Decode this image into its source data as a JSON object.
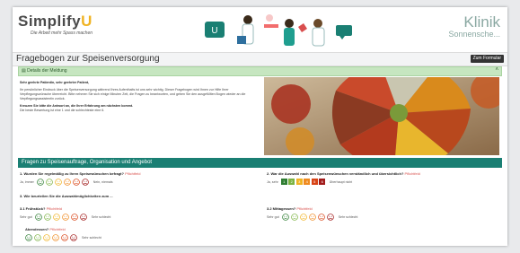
{
  "header": {
    "brand": "Simplify",
    "brand_accent": "U",
    "tagline": "Die Arbeit mehr Spass machen",
    "klinik_line1": "Klinik",
    "klinik_line2": "Sonnensche..."
  },
  "page": {
    "title": "Fragebogen zur Speisenversorgung",
    "forms_button": "Zum Formular"
  },
  "info": {
    "header_label": "Details der Meldung",
    "greeting": "Sehr geehrte Patientin, sehr geehrter Patient,",
    "para1": "Ihr persönlicher Eindruck über die Speisenversorgung während Ihres Aufenthalts ist uns sehr wichtig. Dieser Fragebogen wird Ihnen zur Hilfe Ihrer Verpflegungswünsche überreicht. Bitte nehmen Sie sich einige Minuten Zeit, die Fragen zu beantworten, und geben Sie den ausgefüllten Bogen wieder an die Verpflegungsassistentin zurück.",
    "para2_bold": "Kreuzen Sie bitte die Antwort an, die Ihrer Erfahrung am nächsten kommt.",
    "para3": "Die beste Bewertung ist eine 1 und die schlechteste eine 6."
  },
  "section": {
    "title": "Fragen zu Speisenauftrage, Organisation und Angebot"
  },
  "questions": {
    "q1": {
      "label": "1. Wurden Sie regelmäßig zu Ihren Speisewünschen befragt?",
      "required": "Pflichtfeld",
      "left": "Ja, immer",
      "right": "Nein, niemals"
    },
    "q2": {
      "label": "2. War die Auswahl nach den Speisenwünschen verständlich und übersichtlich?",
      "required": "Pflichtfeld",
      "left": "Ja, sehr",
      "right": "Überhaupt nicht",
      "grades": [
        "1",
        "2",
        "3",
        "4",
        "5",
        "6"
      ]
    },
    "q3": {
      "label": "3. Wie beurteilen Sie die Auswahlmöglichkeiten zum ..."
    },
    "q31": {
      "label": "3.1 Frühstück?",
      "required": "Pflichtfeld",
      "left": "Sehr gut",
      "right": "Sehr schlecht"
    },
    "q32": {
      "label": "3.2 Mittagessen?",
      "required": "Pflichtfeld",
      "left": "Sehr gut",
      "right": "Sehr schlecht"
    },
    "q33": {
      "label": "Abendessen?",
      "required": "Pflichtfeld",
      "left": "",
      "right": "Sehr schlecht"
    }
  },
  "colors": {
    "teal": "#1a7f73",
    "green_header": "#c6e6c0",
    "grades": [
      "#2e7d32",
      "#7cb342",
      "#f0b323",
      "#ef8a1f",
      "#d84315",
      "#a11b1b"
    ]
  }
}
